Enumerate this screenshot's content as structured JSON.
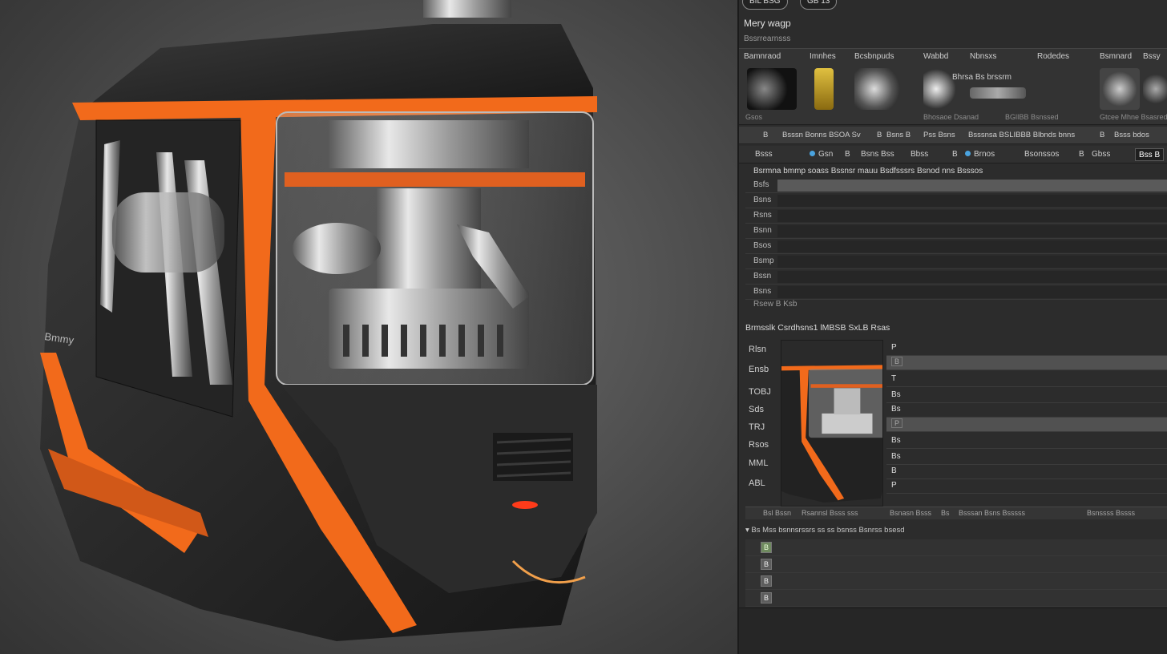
{
  "viewport": {
    "accent_color": "#f26a1b",
    "body_color": "#2a2a2a",
    "side_badge": "Bmmy"
  },
  "panel": {
    "top_pills": [
      "BIL BSG",
      "GB 13"
    ],
    "title": "Mery wagp",
    "subtitle": "Bssrrearnsss",
    "thumbnails": [
      {
        "label": "Bamnraod",
        "caption": "Gsos",
        "color": "#1a1a1a"
      },
      {
        "label": "Imnhes",
        "caption": "",
        "color": "#c9a92a"
      },
      {
        "label": "Bcsbnpuds",
        "caption": "",
        "color": "#6a6a6a"
      },
      {
        "label": "Wabbd",
        "caption": "Bhosaoe Dsanad",
        "color": "#8a8a8a"
      },
      {
        "label": "Nbnsxs",
        "caption": "",
        "color": "#555"
      },
      {
        "label": "Rodedes",
        "caption": "BGlIBB Bsnssed",
        "color": "#777"
      },
      {
        "label": "Bsmnard",
        "caption": "Gtcee Mhne Bsasred",
        "color": "#999"
      },
      {
        "label": "Bssy",
        "caption": "",
        "color": "#aaa"
      }
    ],
    "thumb_overlay": "Bhrsa Bs brssrm",
    "filters": [
      "B",
      "Bsssn Bonns BSOA Sv",
      "B",
      "Bsns B",
      "Pss Bsns",
      "Bsssnsa BSLIBBB Blbnds bnns",
      "B",
      "Bsss bdos"
    ],
    "tabs": [
      "Bsss",
      "Gsn",
      "B",
      "Bsns Bss",
      "Bbss",
      "B",
      "Brnos",
      "Bsonssos",
      "B",
      "Gbss",
      "Bss B"
    ],
    "props": {
      "header": "Bsrmna bmmp soass Bssnsr mauu Bsdfsssrs Bsnod nns Bsssos",
      "rows": [
        "Bsfs",
        "Bsns",
        "Rsns",
        "Bsnn",
        "Bsos",
        "Bsmp",
        "Bssn",
        "Bsns"
      ],
      "footer": "Rsew B Ksb"
    },
    "section2": {
      "header": "Brmsslk Csrdhsns1 lMBSB SxLB Rsas",
      "labels": [
        "Rlsn",
        "Ensb",
        "TOBJ",
        "Sds",
        "TRJ",
        "Rsos",
        "MML",
        "ABL"
      ],
      "list": [
        "P",
        "B",
        "T",
        "Bs",
        "Bs",
        "P",
        "Bs",
        "Bs",
        "B",
        "P"
      ],
      "status": [
        "Bsl Bssn",
        "Rsannsl Bsss sss",
        "Bsnasn Bsss",
        "Bs",
        "Bsssan Bsns Bsssss",
        "Bsnssss Bssss"
      ]
    },
    "section3": {
      "header": "Bs Mss bsnnsrssrs ss ss bsnss Bsnrss bsesd",
      "checks": [
        "B",
        "B",
        "B",
        "B"
      ]
    }
  }
}
